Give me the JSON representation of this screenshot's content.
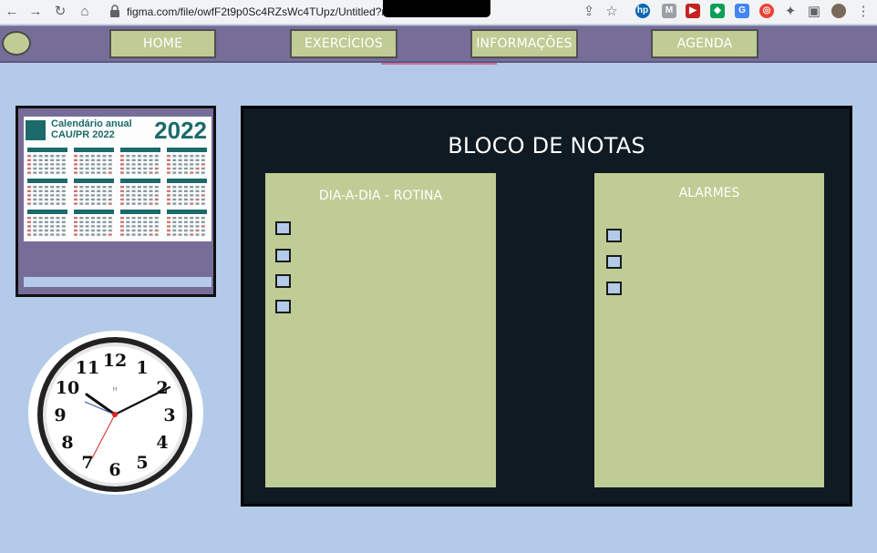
{
  "browser": {
    "url": "figma.com/file/owfF2t9p0Sc4RZsWc4TUpz/Untitled?n",
    "icons": [
      "back-icon",
      "forward-icon",
      "reload-icon",
      "home-icon",
      "lock-icon",
      "share-icon",
      "star-icon",
      "extensions-icon",
      "sidebar-icon",
      "profile-icon",
      "menu-icon"
    ]
  },
  "nav": {
    "items": [
      {
        "label": "HOME"
      },
      {
        "label": "EXERCÍCIOS"
      },
      {
        "label": "INFORMAÇÕES"
      },
      {
        "label": "AGENDA"
      }
    ]
  },
  "calendar": {
    "title": "Calendário anual",
    "subtitle": "CAU/PR 2022",
    "year": "2022"
  },
  "clock": {
    "numbers": [
      "12",
      "1",
      "2",
      "3",
      "4",
      "5",
      "6",
      "7",
      "8",
      "9",
      "10",
      "11"
    ]
  },
  "notes": {
    "title": "BLOCO DE NOTAS",
    "left": {
      "title": "DIA-A-DIA - ROTINA",
      "checkbox_count": 4
    },
    "right": {
      "title": "ALARMES",
      "checkbox_count": 3
    }
  },
  "colors": {
    "background": "#b3cbe9",
    "navbar": "#766d99",
    "accent_green": "#bfcc95",
    "panel": "#0f1a22"
  }
}
